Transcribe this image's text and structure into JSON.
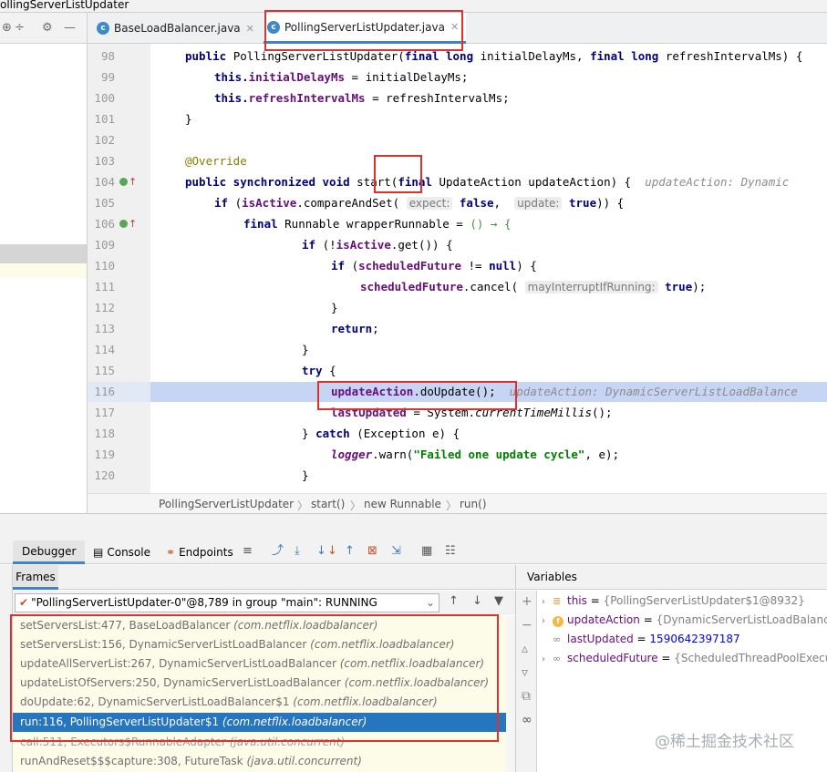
{
  "window": {
    "title": "ollingServerListUpdater"
  },
  "editor_tabs": [
    {
      "label": "BaseLoadBalancer.java",
      "active": false
    },
    {
      "label": "PollingServerListUpdater.java",
      "active": true
    }
  ],
  "code_lines": [
    {
      "n": "98"
    },
    {
      "n": "99"
    },
    {
      "n": "100"
    },
    {
      "n": "101"
    },
    {
      "n": "102"
    },
    {
      "n": "103"
    },
    {
      "n": "104"
    },
    {
      "n": "105"
    },
    {
      "n": "106"
    },
    {
      "n": "109"
    },
    {
      "n": "110"
    },
    {
      "n": "111"
    },
    {
      "n": "112"
    },
    {
      "n": "113"
    },
    {
      "n": "114"
    },
    {
      "n": "115"
    },
    {
      "n": "116"
    },
    {
      "n": "117"
    },
    {
      "n": "118"
    },
    {
      "n": "119"
    },
    {
      "n": "120"
    }
  ],
  "code": {
    "l98_a": "public ",
    "l98_b": "PollingServerListUpdater(",
    "l98_c": "final long ",
    "l98_d": "initialDelayMs, ",
    "l98_e": "final long ",
    "l98_f": "refreshIntervalMs) {",
    "l99_a": "this.",
    "l99_b": "initialDelayMs",
    "l99_c": " = initialDelayMs;",
    "l100_a": "this.",
    "l100_b": "refreshIntervalMs",
    "l100_c": " = refreshIntervalMs;",
    "l101": "}",
    "l103": "@Override",
    "l104_a": "public synchronized void ",
    "l104_b": "start(",
    "l104_c": "final ",
    "l104_d": "UpdateAction updateAction) {",
    "l104_hint": "updateAction: Dynamic",
    "l105_a": "if ",
    "l105_b": "(",
    "l105_c": "isActive",
    "l105_d": ".compareAndSet(",
    "l105_e": "expect:",
    "l105_f": "false",
    "l105_g": ", ",
    "l105_h": "update:",
    "l105_i": "true",
    "l105_j": ")) {",
    "l106_a": "final ",
    "l106_b": "Runnable wrapperRunnable = ",
    "l106_c": "() → {",
    "l109_a": "if ",
    "l109_b": "(!",
    "l109_c": "isActive",
    "l109_d": ".get()) {",
    "l110_a": "if ",
    "l110_b": "(",
    "l110_c": "scheduledFuture",
    "l110_d": " != ",
    "l110_e": "null",
    "l110_f": ") {",
    "l111_a": "scheduledFuture",
    "l111_b": ".cancel(",
    "l111_c": "mayInterruptIfRunning:",
    "l111_d": "true",
    "l111_e": ");",
    "l112": "}",
    "l113_a": "return",
    "l113_b": ";",
    "l114": "}",
    "l115_a": "try ",
    "l115_b": "{",
    "l116_a": "updateAction",
    "l116_b": ".doUpdate();",
    "l116_hint": "updateAction: DynamicServerListLoadBalance",
    "l117_a": "lastUpdated",
    "l117_b": " = System.",
    "l117_c": "currentTimeMillis",
    "l117_d": "();",
    "l118_a": "} ",
    "l118_b": "catch ",
    "l118_c": "(Exception e) {",
    "l119_a": "logger",
    "l119_b": ".warn(",
    "l119_c": "\"Failed one update cycle\"",
    "l119_d": ", e);",
    "l120": "}"
  },
  "breadcrumb": [
    "PollingServerListUpdater",
    "start()",
    "new Runnable",
    "run()"
  ],
  "debugger": {
    "tabs": [
      "Debugger",
      "Console",
      "Endpoints"
    ],
    "frames_label": "Frames",
    "variables_label": "Variables",
    "thread": "\"PollingServerListUpdater-0\"@8,789 in group \"main\": RUNNING",
    "frames": [
      {
        "method": "setServersList:477, BaseLoadBalancer",
        "pkg": "(com.netflix.loadbalancer)"
      },
      {
        "method": "setServersList:156, DynamicServerListLoadBalancer",
        "pkg": "(com.netflix.loadbalancer)"
      },
      {
        "method": "updateAllServerList:267, DynamicServerListLoadBalancer",
        "pkg": "(com.netflix.loadbalancer)"
      },
      {
        "method": "updateListOfServers:250, DynamicServerListLoadBalancer",
        "pkg": "(com.netflix.loadbalancer)"
      },
      {
        "method": "doUpdate:62, DynamicServerListLoadBalancer$1",
        "pkg": "(com.netflix.loadbalancer)"
      },
      {
        "method": "run:116, PollingServerListUpdater$1",
        "pkg": "(com.netflix.loadbalancer)"
      },
      {
        "method": "call:511, Executors$RunnableAdapter",
        "pkg": "(java.util.concurrent)"
      },
      {
        "method": "runAndReset$$$capture:308, FutureTask",
        "pkg": "(java.util.concurrent)"
      }
    ],
    "selected_frame_index": 5,
    "variables": [
      {
        "name": "this",
        "value": "{PollingServerListUpdater$1@8932}"
      },
      {
        "name": "updateAction",
        "value": "{DynamicServerListLoadBalance"
      },
      {
        "name": "lastUpdated",
        "value": "1590642397187"
      },
      {
        "name": "scheduledFuture",
        "value": "{ScheduledThreadPoolExecu"
      }
    ]
  },
  "watermark": "@稀土掘金技术社区"
}
